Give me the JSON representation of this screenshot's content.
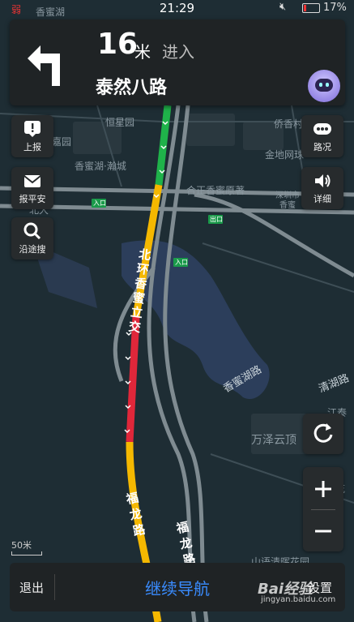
{
  "status_bar": {
    "left_text": "弱",
    "time": "21:29",
    "battery_percent": "17%",
    "battery_level": 0.17
  },
  "nav": {
    "distance": "16",
    "distance_unit": "米",
    "action": "进入",
    "road_name": "泰然八路"
  },
  "side_left": [
    {
      "label": "上报",
      "icon": "exclamation-icon"
    },
    {
      "label": "报平安",
      "icon": "envelope-icon"
    },
    {
      "label": "沿途搜",
      "icon": "search-icon"
    }
  ],
  "side_right": [
    {
      "label": "路况",
      "icon": "traffic-dots-icon"
    },
    {
      "label": "详细",
      "icon": "speaker-icon"
    }
  ],
  "map_labels": {
    "top_partial": "香蜜湖",
    "qiaoxiang": "侨香村",
    "jinshi": "金地网球",
    "hengxing": "恒星园",
    "xiangmi_yuan": "嘉园",
    "xiangmi_lake": "香蜜湖·瀚城",
    "hezheng": "合正香蜜原著",
    "shenzhen_city": "深圳市",
    "xiangmi_short": "香蜜",
    "wanze": "万泽云顶",
    "entrance_1": "入口",
    "entrance_2": "入口",
    "exit": "出口",
    "side_road_1": "江泰",
    "left_road": "北大",
    "bottom_partial": "山语清晖花园",
    "lianhua": "连花",
    "qinghu": "清湖路"
  },
  "road_labels": {
    "beihuan": "北环香蜜立交",
    "fulong_1": "福龙路",
    "fulong_2": "福龙路",
    "xiangmihu_road": "香蜜湖路",
    "qinghu_road": "清湖路"
  },
  "scale": "50米",
  "bottom": {
    "exit": "退出",
    "continue": "继续导航",
    "settings": "设置"
  },
  "watermark": {
    "brand": "Bai经验",
    "url": "jingyan.baidu.com"
  },
  "colors": {
    "route_green": "#1fb24a",
    "route_yellow": "#f5b800",
    "route_red": "#e0273a",
    "accent_blue": "#3a8cff"
  }
}
